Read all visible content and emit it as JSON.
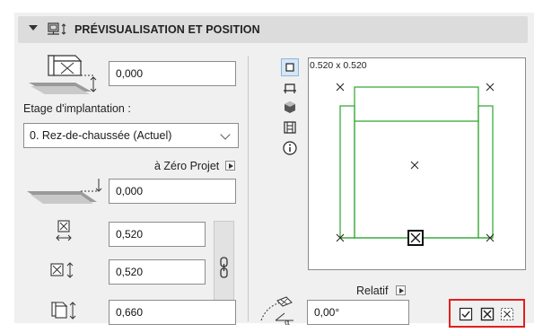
{
  "header": {
    "title": "PRÉVISUALISATION ET POSITION"
  },
  "left": {
    "elevation_value": "0,000",
    "story_label": "Etage d'implantation :",
    "story_selected": "0. Rez-de-chaussée (Actuel)",
    "reference_label": "à Zéro Projet",
    "reference_value": "0,000",
    "width_value": "0,520",
    "depth_value": "0,520",
    "height_value": "0,660"
  },
  "preview": {
    "size_label": "0.520 x 0.520",
    "view_tools": [
      "plan-view-icon",
      "section-view-icon",
      "3d-view-icon",
      "elevation-view-icon",
      "info-icon"
    ]
  },
  "rotation": {
    "relative_label": "Relatif",
    "angle_value": "0,00°"
  },
  "colors": {
    "accent_red": "#e02020",
    "preview_green": "#2da52d"
  }
}
